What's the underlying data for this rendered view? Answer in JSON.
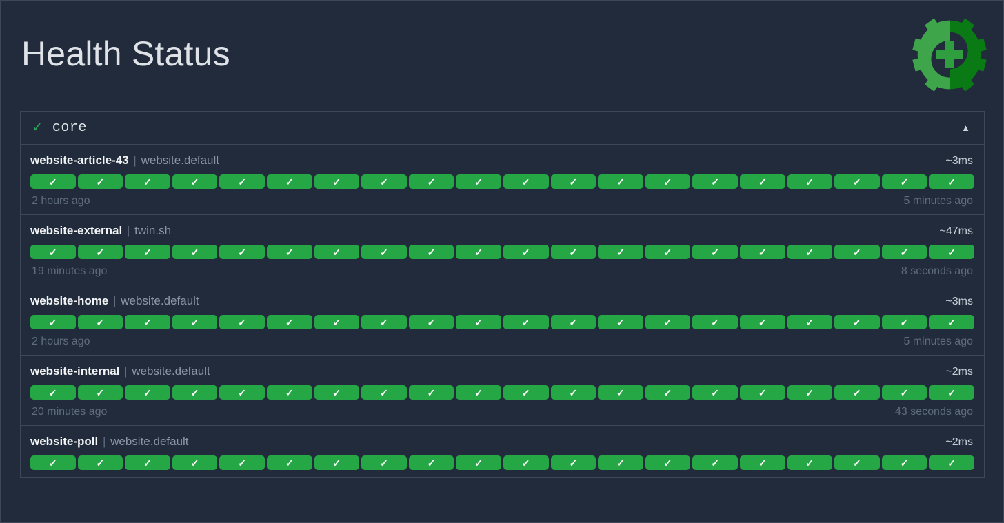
{
  "header": {
    "title": "Health Status",
    "logo_icon": "gear-plus-health-icon",
    "logo_color_light": "#3ea54a",
    "logo_color_dark": "#0a7a14"
  },
  "group": {
    "status_icon": "check-icon",
    "status_symbol": "✓",
    "name": "core",
    "collapse_icon": "triangle-up-icon",
    "collapse_symbol": "▲",
    "expanded": true
  },
  "colors": {
    "background": "#212b3b",
    "border": "#3d4757",
    "up": "#26a745",
    "down": "#c9302c",
    "accent_green": "#2eaa5c",
    "muted_text": "#5f6c7d"
  },
  "bar_glyph": "✓",
  "services": [
    {
      "name": "website-article-43",
      "separator": "|",
      "group": "website.default",
      "latency": "~3ms",
      "oldest_time": "2 hours ago",
      "newest_time": "5 minutes ago",
      "statuses": [
        "up",
        "up",
        "up",
        "up",
        "up",
        "up",
        "up",
        "up",
        "up",
        "up",
        "up",
        "up",
        "up",
        "up",
        "up",
        "up",
        "up",
        "up",
        "up",
        "up"
      ]
    },
    {
      "name": "website-external",
      "separator": "|",
      "group": "twin.sh",
      "latency": "~47ms",
      "oldest_time": "19 minutes ago",
      "newest_time": "8 seconds ago",
      "statuses": [
        "up",
        "up",
        "up",
        "up",
        "up",
        "up",
        "up",
        "up",
        "up",
        "up",
        "up",
        "up",
        "up",
        "up",
        "up",
        "up",
        "up",
        "up",
        "up",
        "up"
      ]
    },
    {
      "name": "website-home",
      "separator": "|",
      "group": "website.default",
      "latency": "~3ms",
      "oldest_time": "2 hours ago",
      "newest_time": "5 minutes ago",
      "statuses": [
        "up",
        "up",
        "up",
        "up",
        "up",
        "up",
        "up",
        "up",
        "up",
        "up",
        "up",
        "up",
        "up",
        "up",
        "up",
        "up",
        "up",
        "up",
        "up",
        "up"
      ]
    },
    {
      "name": "website-internal",
      "separator": "|",
      "group": "website.default",
      "latency": "~2ms",
      "oldest_time": "20 minutes ago",
      "newest_time": "43 seconds ago",
      "statuses": [
        "up",
        "up",
        "up",
        "up",
        "up",
        "up",
        "up",
        "up",
        "up",
        "up",
        "up",
        "up",
        "up",
        "up",
        "up",
        "up",
        "up",
        "up",
        "up",
        "up"
      ]
    },
    {
      "name": "website-poll",
      "separator": "|",
      "group": "website.default",
      "latency": "~2ms",
      "oldest_time": "",
      "newest_time": "",
      "statuses": [
        "up",
        "up",
        "up",
        "up",
        "up",
        "up",
        "up",
        "up",
        "up",
        "up",
        "up",
        "up",
        "up",
        "up",
        "up",
        "up",
        "up",
        "up",
        "up",
        "up"
      ]
    }
  ]
}
